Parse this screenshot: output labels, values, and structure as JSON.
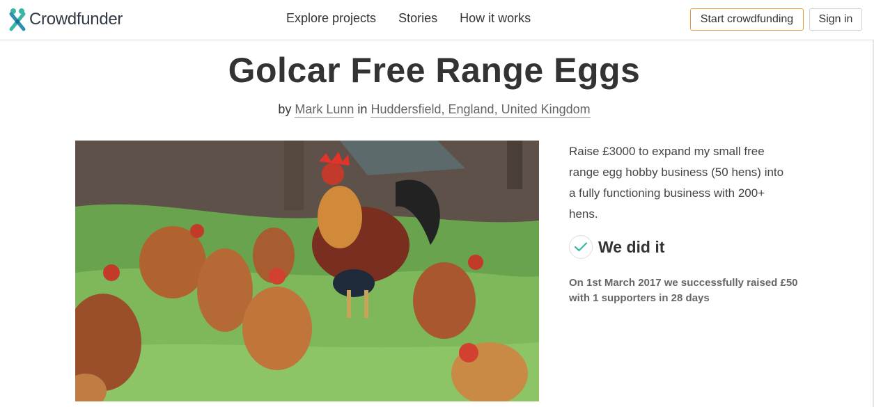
{
  "header": {
    "brand": "Crowdfunder",
    "nav": [
      "Explore projects",
      "Stories",
      "How it works"
    ],
    "start_label": "Start crowdfunding",
    "signin_label": "Sign in",
    "accent_color": "#e49a3b",
    "logo_icon": "crowdfunder-logo-icon"
  },
  "project": {
    "title": "Golcar Free Range Eggs",
    "by_word": "by",
    "author": "Mark Lunn",
    "in_word": "in",
    "location": "Huddersfield, England, United Kingdom",
    "description": "Raise £3000 to expand my small free range egg hobby business (50 hens) into a fully functioning business with 200+ hens.",
    "status_label": "We did it",
    "status_icon": "checkmark-icon",
    "raised_text": "On 1st March 2017 we successfully raised £50 with 1 supporters in 28 days",
    "image": "hens-and-rooster-photo"
  }
}
